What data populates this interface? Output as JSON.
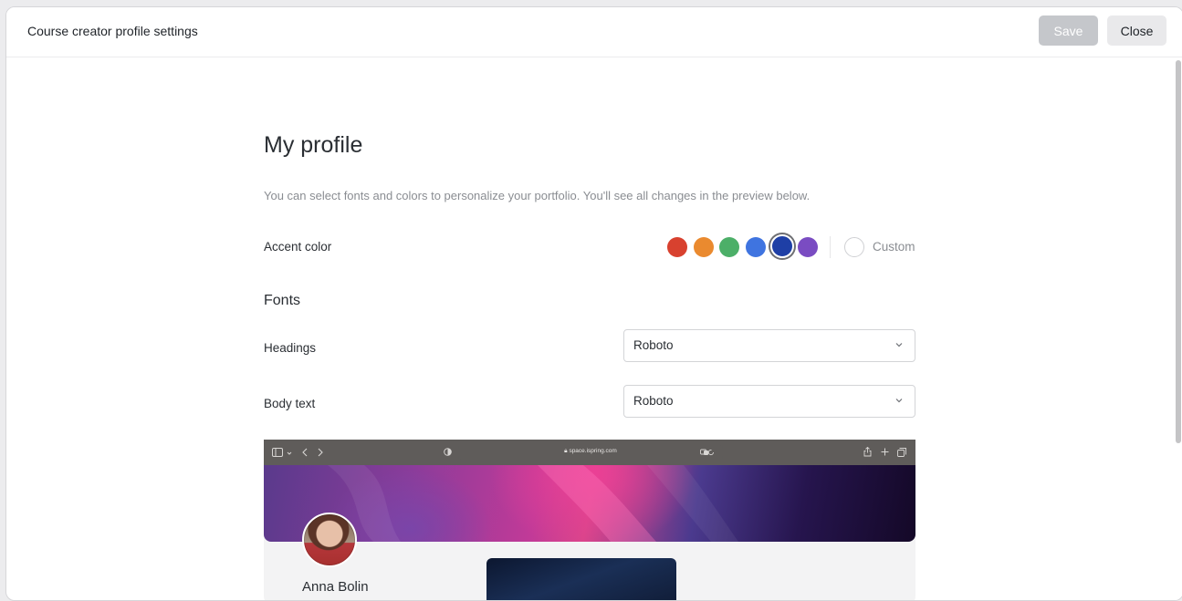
{
  "window": {
    "title": "Course creator profile settings",
    "save_label": "Save",
    "close_label": "Close"
  },
  "profile": {
    "title": "My profile",
    "intro": "You can select fonts and colors to personalize your portfolio. You'll see all changes in the preview below."
  },
  "accent": {
    "label": "Accent color",
    "colors": [
      "#d8412f",
      "#ea8a2f",
      "#4caf68",
      "#3f74e0",
      "#1e3fa6",
      "#7a4cc2"
    ],
    "selected_index": 4,
    "custom_label": "Custom"
  },
  "fonts": {
    "title": "Fonts",
    "headings": {
      "label": "Headings",
      "value": "Roboto"
    },
    "body": {
      "label": "Body text",
      "value": "Roboto"
    }
  },
  "preview": {
    "address": "space.ispring.com",
    "name": "Anna Bolin"
  }
}
